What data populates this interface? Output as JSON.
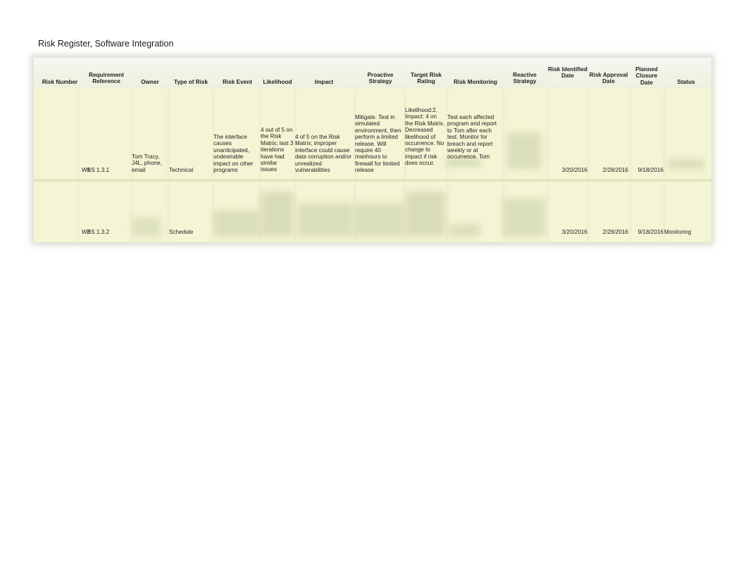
{
  "title": "Risk Register, Software Integration",
  "columns": [
    "Risk Number",
    "Requirement Reference",
    "Owner",
    "Type of Risk",
    "Risk Event",
    "Likelihood",
    "Impact",
    "Proactive Strategy",
    "Target Risk Rating",
    "Risk Monitoring",
    "Reactive Strategy",
    "Risk Identified Date",
    "Risk Approval Date",
    "Planned Closure Date",
    "Status"
  ],
  "rows": [
    {
      "risk_number": "1",
      "requirement_reference": "WBS 1.3.1",
      "owner": "Tom Tracy, J4L, phone, email",
      "type_of_risk": "Technical",
      "risk_event": "The interface causes unanticipated, undesirable impact on other programs",
      "likelihood": "4 out of 5 on the Risk Matrix; last 3 iterations have had similar issues",
      "impact": "4 of 5 on the Risk Matrix; improper interface could cause data corruption and/or unrealized vulnerabilities",
      "proactive_strategy": "Mitigate.  Test in simulated environment, then perform a limited release. Will require 40 manhours to firewall for limited release",
      "target_risk_rating": "Likelihood:2, Impact: 4 on the Risk Matrix. Decreased likelihood of occurrence. No change to impact if risk does occur.",
      "risk_monitoring": "Test each affected program and report to Tom after each test.  Monitor for breach and report weekly or at occurrence.  Tom",
      "reactive_strategy": "",
      "risk_identified_date": "3/20/2016",
      "risk_approval_date": "2/28/2016",
      "planned_closure_date": "9/18/2016",
      "status": ""
    },
    {
      "risk_number": "2",
      "requirement_reference": "WBS 1.3.2",
      "owner": "",
      "type_of_risk": "Schedule",
      "risk_event": "",
      "likelihood": "",
      "impact": "",
      "proactive_strategy": "",
      "target_risk_rating": "",
      "risk_monitoring": "",
      "reactive_strategy": "",
      "risk_identified_date": "3/20/2016",
      "risk_approval_date": "2/28/2016",
      "planned_closure_date": "9/18/2016",
      "status": "Monitoring"
    }
  ]
}
